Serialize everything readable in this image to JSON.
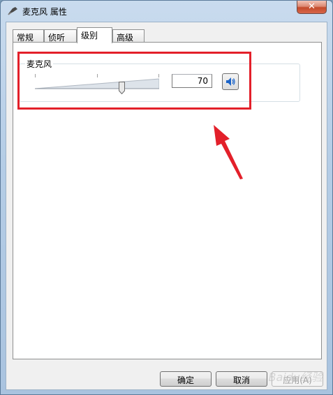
{
  "window": {
    "title": "麦克风 属性"
  },
  "tabs": [
    {
      "label": "常规",
      "active": false
    },
    {
      "label": "侦听",
      "active": false
    },
    {
      "label": "级别",
      "active": true
    },
    {
      "label": "高级",
      "active": false
    }
  ],
  "level": {
    "group_label": "麦克风",
    "value": "70",
    "slider_fraction": 0.7,
    "icons": [
      "speaker-icon"
    ]
  },
  "buttons": {
    "ok": "确定",
    "cancel": "取消",
    "apply": "应用(A)"
  },
  "colors": {
    "annotation": "#e3202a",
    "speaker": "#1a63c8"
  },
  "watermark": "Baidu经验"
}
